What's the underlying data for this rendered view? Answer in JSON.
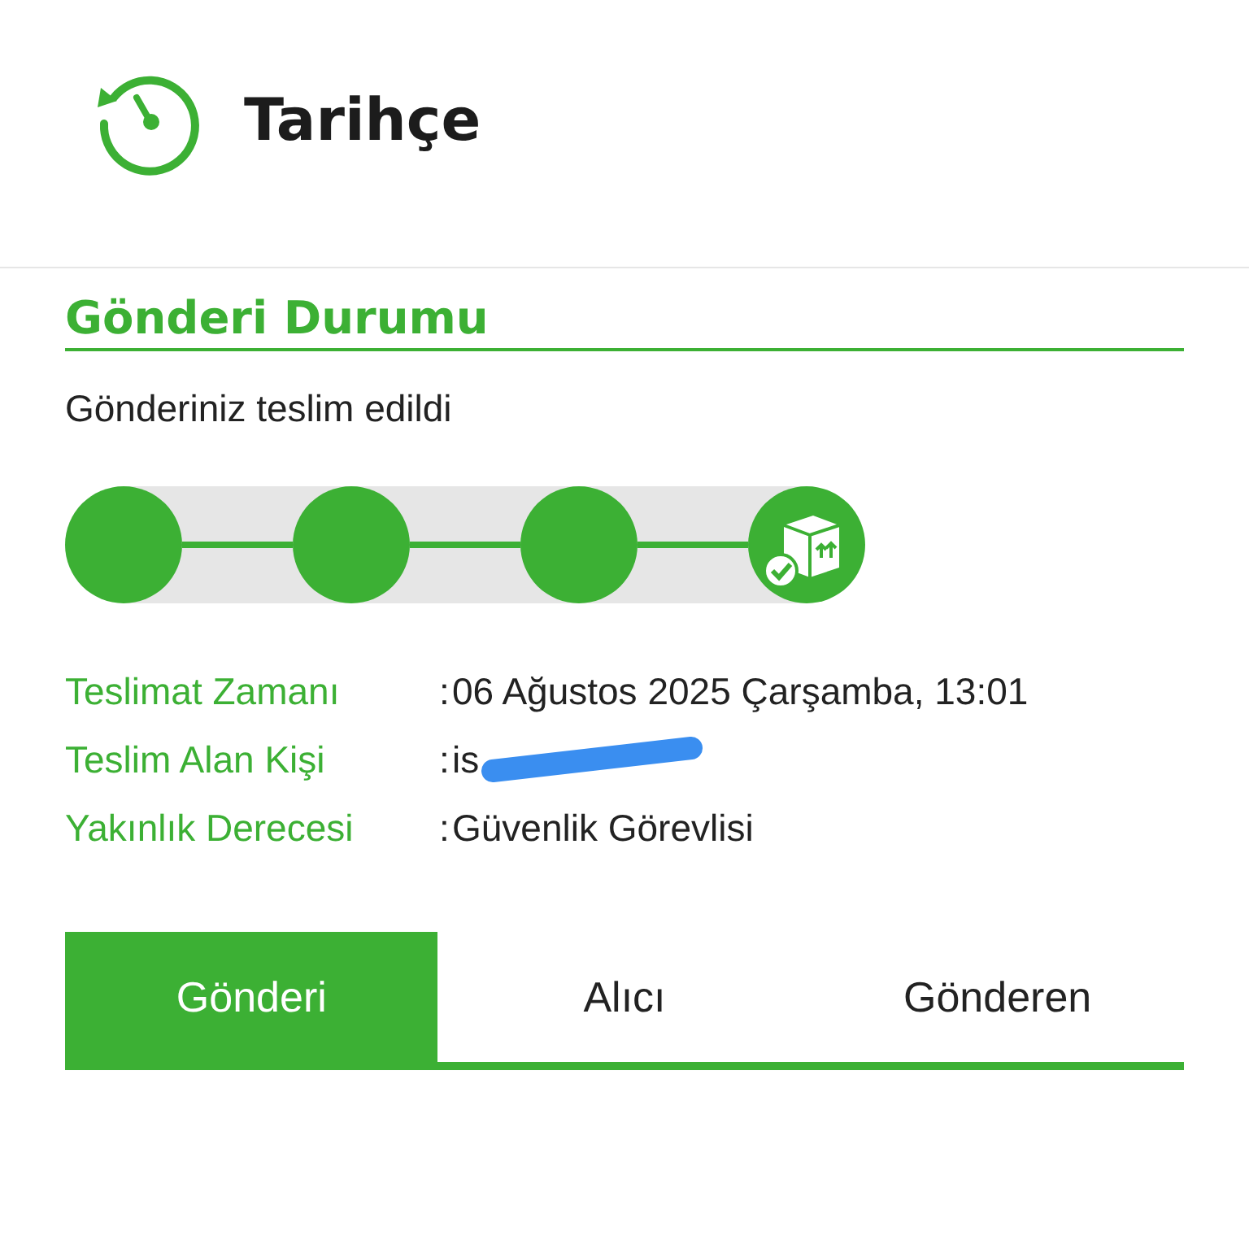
{
  "header": {
    "title": "Tarihçe"
  },
  "section": {
    "title": "Gönderi Durumu",
    "status": "Gönderiniz teslim edildi"
  },
  "steps": [
    {
      "kind": "dot",
      "done": true
    },
    {
      "kind": "dot",
      "done": true
    },
    {
      "kind": "dot",
      "done": true
    },
    {
      "kind": "delivered",
      "done": true
    }
  ],
  "details": [
    {
      "kind": "text",
      "label": "Teslimat Zamanı",
      "separator": ":",
      "value": "06 Ağustos 2025 Çarşamba, 13:01"
    },
    {
      "kind": "redacted",
      "label": "Teslim Alan Kişi",
      "separator": ":",
      "value": "is"
    },
    {
      "kind": "text",
      "label": "Yakınlık Derecesi",
      "separator": ":",
      "value": "Güvenlik Görevlisi"
    }
  ],
  "tabs": [
    {
      "label": "Gönderi",
      "selected": true
    },
    {
      "label": "Alıcı",
      "selected": false
    },
    {
      "label": "Gönderen",
      "selected": false
    }
  ]
}
